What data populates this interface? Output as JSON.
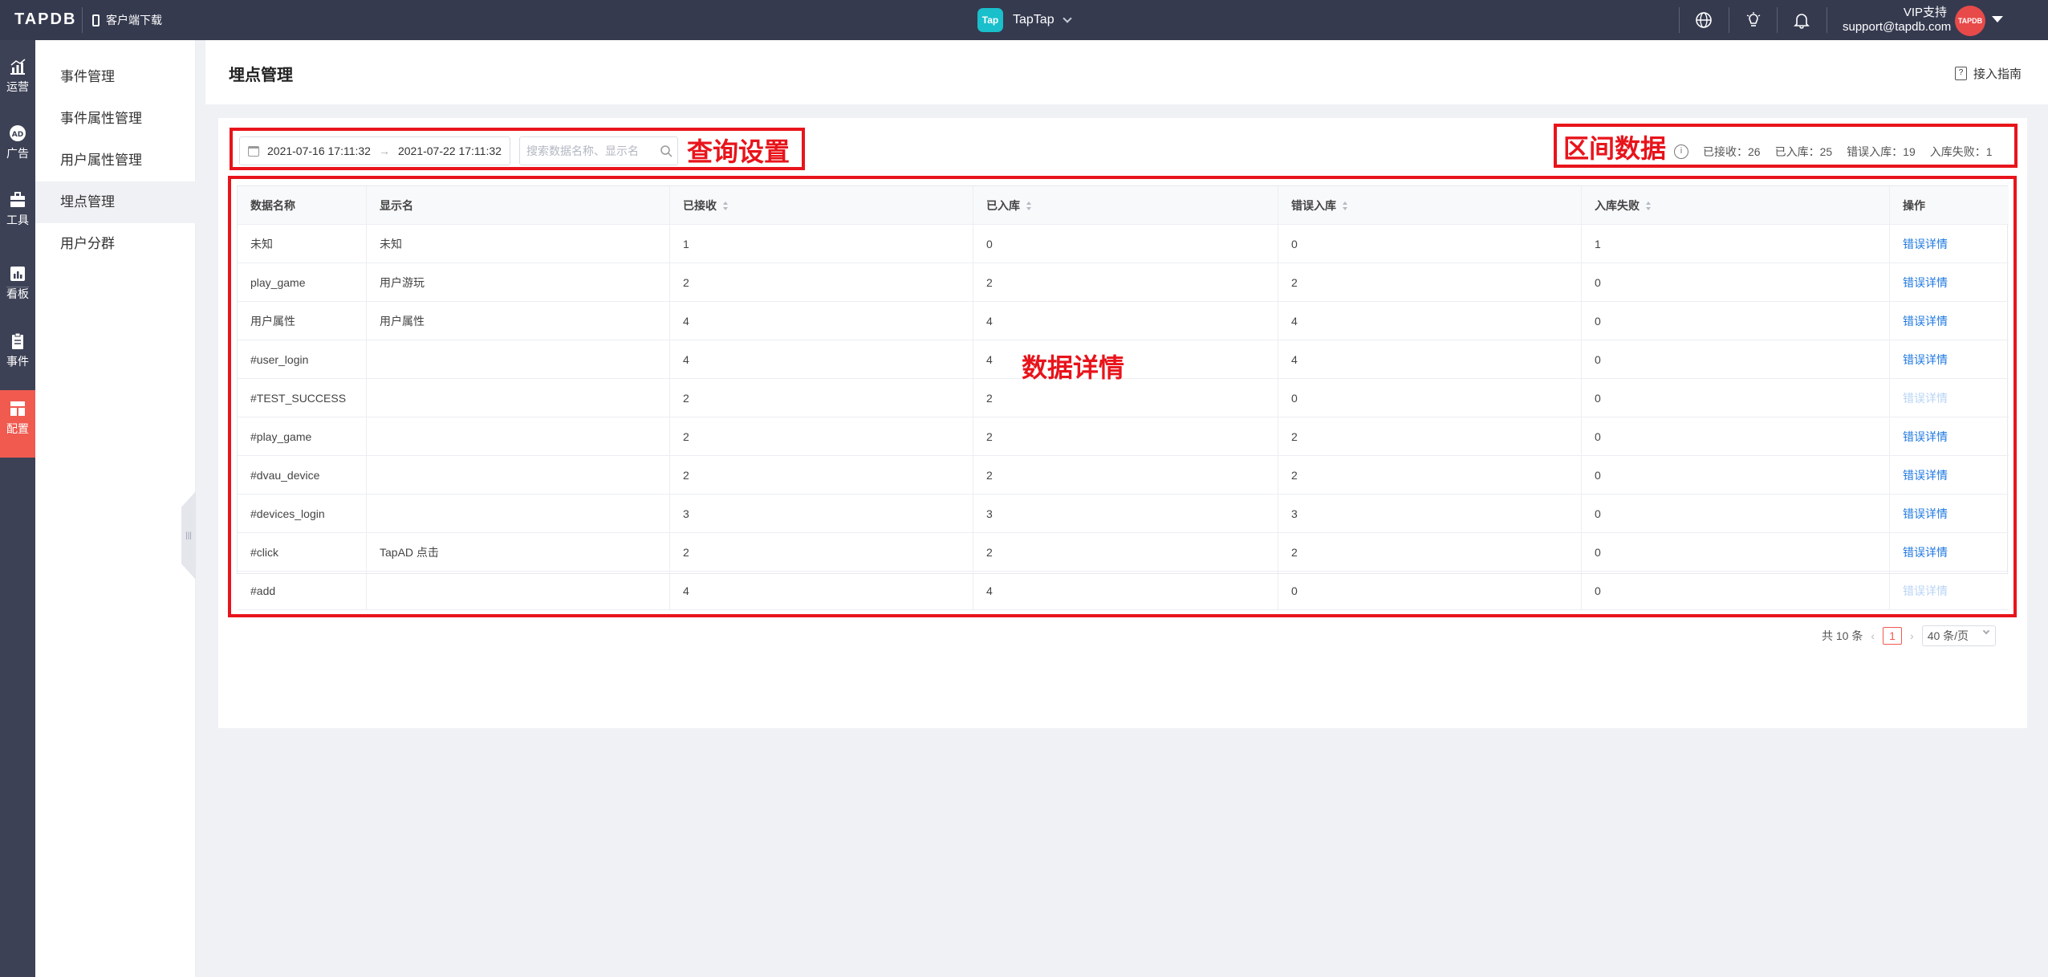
{
  "topbar": {
    "logo": "TAPDB",
    "download_label": "客户端下载",
    "app_logo_text": "Tap",
    "app_name": "TapTap",
    "vip_label": "VIP支持",
    "support_email": "support@tapdb.com",
    "avatar_text": "TAPDB"
  },
  "leftnav": {
    "items": [
      {
        "label": "运营",
        "icon": "chart-icon"
      },
      {
        "label": "广告",
        "icon": "ad-icon"
      },
      {
        "label": "工具",
        "icon": "toolbox-icon"
      },
      {
        "label": "看板",
        "icon": "dashboard-icon"
      },
      {
        "label": "事件",
        "icon": "clipboard-icon"
      },
      {
        "label": "配置",
        "icon": "layout-icon"
      }
    ],
    "active_color": "#f05a4f"
  },
  "subnav": {
    "items": [
      {
        "label": "事件管理"
      },
      {
        "label": "事件属性管理"
      },
      {
        "label": "用户属性管理"
      },
      {
        "label": "埋点管理"
      },
      {
        "label": "用户分群"
      }
    ],
    "active": "埋点管理"
  },
  "header": {
    "title": "埋点管理",
    "guide_label": "接入指南"
  },
  "query": {
    "date_start": "2021-07-16 17:11:32",
    "date_separator": "→",
    "date_end": "2021-07-22 17:11:32",
    "search_placeholder": "搜索数据名称、显示名"
  },
  "annotations": {
    "query_label": "查询设置",
    "range_label": "区间数据",
    "detail_label": "数据详情",
    "color": "#e8141b"
  },
  "stats": {
    "received": "已接收：26",
    "stored": "已入库：25",
    "error": "错误入库：19",
    "failed": "入库失败：1"
  },
  "table": {
    "headers": [
      "数据名称",
      "显示名",
      "已接收",
      "已入库",
      "错误入库",
      "入库失败",
      "操作"
    ],
    "rows": [
      {
        "name": "未知",
        "display": "未知",
        "received": "1",
        "stored": "0",
        "error": "0",
        "failed": "1",
        "action": "错误详情",
        "action_disabled": false
      },
      {
        "name": "play_game",
        "display": "用户游玩",
        "received": "2",
        "stored": "2",
        "error": "2",
        "failed": "0",
        "action": "错误详情",
        "action_disabled": false
      },
      {
        "name": "用户属性",
        "display": "用户属性",
        "received": "4",
        "stored": "4",
        "error": "4",
        "failed": "0",
        "action": "错误详情",
        "action_disabled": false
      },
      {
        "name": "#user_login",
        "display": "",
        "received": "4",
        "stored": "4",
        "error": "4",
        "failed": "0",
        "action": "错误详情",
        "action_disabled": false
      },
      {
        "name": "#TEST_SUCCESS",
        "display": "",
        "received": "2",
        "stored": "2",
        "error": "0",
        "failed": "0",
        "action": "错误详情",
        "action_disabled": true
      },
      {
        "name": "#play_game",
        "display": "",
        "received": "2",
        "stored": "2",
        "error": "2",
        "failed": "0",
        "action": "错误详情",
        "action_disabled": false
      },
      {
        "name": "#dvau_device",
        "display": "",
        "received": "2",
        "stored": "2",
        "error": "2",
        "failed": "0",
        "action": "错误详情",
        "action_disabled": false
      },
      {
        "name": "#devices_login",
        "display": "",
        "received": "3",
        "stored": "3",
        "error": "3",
        "failed": "0",
        "action": "错误详情",
        "action_disabled": false
      },
      {
        "name": "#click",
        "display": "TapAD 点击",
        "received": "2",
        "stored": "2",
        "error": "2",
        "failed": "0",
        "action": "错误详情",
        "action_disabled": false
      },
      {
        "name": "#add",
        "display": "",
        "received": "4",
        "stored": "4",
        "error": "0",
        "failed": "0",
        "action": "错误详情",
        "action_disabled": true
      }
    ]
  },
  "pagination": {
    "total": "共 10 条",
    "prev": "‹",
    "current_page": "1",
    "next": "›",
    "page_size": "40 条/页"
  }
}
